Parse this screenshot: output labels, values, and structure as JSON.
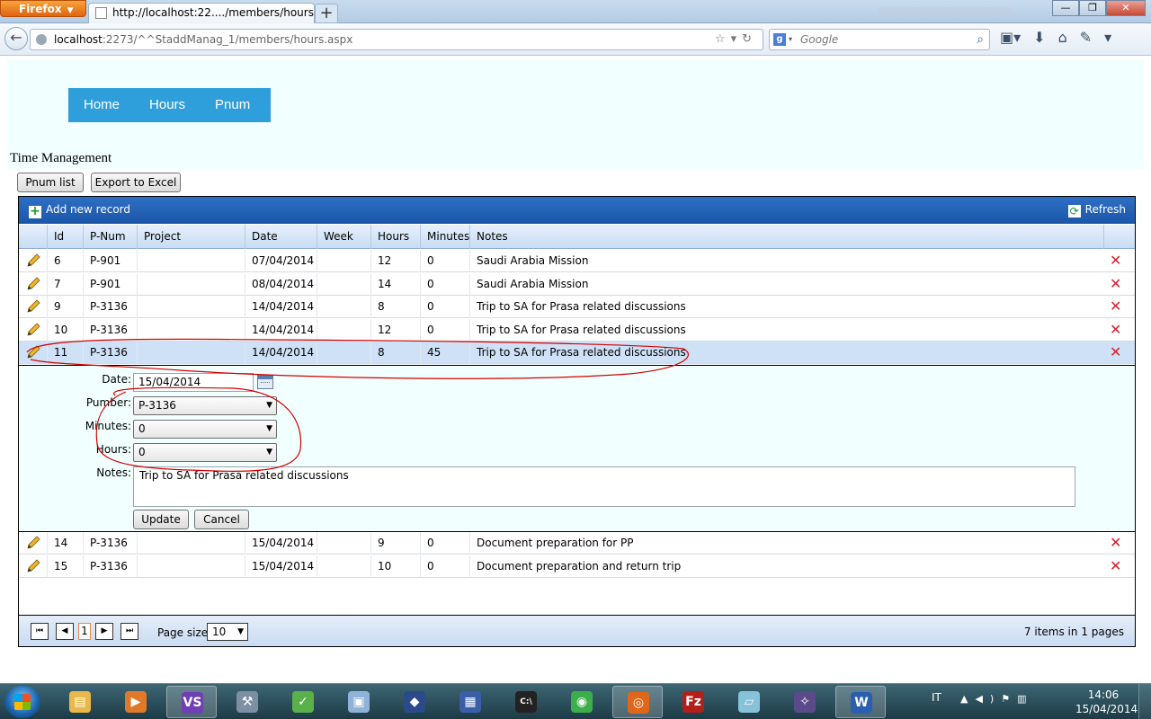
{
  "browser": {
    "menu_label": "Firefox",
    "tab_title": "http://localhost:22..../members/hours.aspx",
    "new_tab_label": "+",
    "window_controls": {
      "minimize": "—",
      "maximize": "❐",
      "close": "✕"
    },
    "url_host": "localhost",
    "url_rest": ":2273/^^StaddManag_1/members/hours.aspx",
    "search_placeholder": "Google"
  },
  "site": {
    "nav": [
      "Home",
      "Hours",
      "Pnum"
    ],
    "page_title": "Time Management"
  },
  "toolbar": {
    "pnum_list": "Pnum list",
    "export": "Export to Excel"
  },
  "grid": {
    "add_label": "Add new record",
    "refresh_label": "Refresh",
    "columns": [
      "Id",
      "P-Num",
      "Project",
      "Date",
      "Week",
      "Hours",
      "Minutes",
      "Notes"
    ],
    "rows_before": [
      {
        "id": "6",
        "pnum": "P-901",
        "project": "",
        "date": "07/04/2014",
        "week": "",
        "hours": "12",
        "minutes": "0",
        "notes": "Saudi Arabia Mission"
      },
      {
        "id": "7",
        "pnum": "P-901",
        "project": "",
        "date": "08/04/2014",
        "week": "",
        "hours": "14",
        "minutes": "0",
        "notes": "Saudi Arabia Mission"
      },
      {
        "id": "9",
        "pnum": "P-3136",
        "project": "",
        "date": "14/04/2014",
        "week": "",
        "hours": "8",
        "minutes": "0",
        "notes": "Trip to SA for Prasa related discussions"
      },
      {
        "id": "10",
        "pnum": "P-3136",
        "project": "",
        "date": "14/04/2014",
        "week": "",
        "hours": "12",
        "minutes": "0",
        "notes": "Trip to SA for Prasa related discussions"
      },
      {
        "id": "11",
        "pnum": "P-3136",
        "project": "",
        "date": "14/04/2014",
        "week": "",
        "hours": "8",
        "minutes": "45",
        "notes": "Trip to SA for Prasa related discussions"
      }
    ],
    "rows_after": [
      {
        "id": "14",
        "pnum": "P-3136",
        "project": "",
        "date": "15/04/2014",
        "week": "",
        "hours": "9",
        "minutes": "0",
        "notes": "Document preparation for PP"
      },
      {
        "id": "15",
        "pnum": "P-3136",
        "project": "",
        "date": "15/04/2014",
        "week": "",
        "hours": "10",
        "minutes": "0",
        "notes": "Document preparation and return trip"
      }
    ],
    "selected_row_id": "11",
    "edit_form": {
      "date_label": "Date:",
      "date_value": "15/04/2014",
      "pnum_label": "Pumber:",
      "pnum_value": "P-3136",
      "minutes_label": "Minutes:",
      "minutes_value": "0",
      "hours_label": "Hours:",
      "hours_value": "0",
      "notes_label": "Notes:",
      "notes_value": "Trip to SA for Prasa related discussions",
      "update_label": "Update",
      "cancel_label": "Cancel"
    },
    "pager": {
      "first": "⏮",
      "prev": "◀",
      "current_page": "1",
      "next": "▶",
      "last": "⏭",
      "page_size_label": "Page size:",
      "page_size_value": "10",
      "info_prefix": "7 items in ",
      "info_pages": "1",
      "info_suffix": " pages"
    }
  },
  "taskbar": {
    "apps": [
      "explorer-icon",
      "media-player-icon",
      "visual-studio-icon",
      "tools-icon",
      "notepad-icon",
      "box-icon",
      "bird-icon",
      "vm-icon",
      "cmd-icon",
      "chrome-icon",
      "firefox-icon",
      "filezilla-icon",
      "note-icon",
      "wand-icon",
      "word-icon"
    ],
    "language": "IT",
    "time": "14:06",
    "date": "15/04/2014"
  },
  "colors": {
    "menu_bg": "#2f9fdb",
    "header_bg": "#f2ffff",
    "grid_command_bar": "#1b56a8",
    "selected_row": "#cfe1f7",
    "annotation": "#d40000"
  }
}
